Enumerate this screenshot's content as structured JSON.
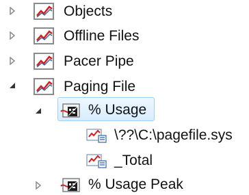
{
  "tree": {
    "items": [
      {
        "label": "Objects",
        "expander": "chevron-right-icon",
        "icon": "performance-chart-icon"
      },
      {
        "label": "Offline Files",
        "expander": "chevron-right-icon",
        "icon": "performance-chart-icon"
      },
      {
        "label": "Pacer Pipe",
        "expander": "chevron-right-icon",
        "icon": "performance-chart-icon"
      },
      {
        "label": "Paging File",
        "expander": "chevron-down-icon",
        "icon": "performance-chart-icon"
      },
      {
        "label": "% Usage",
        "expander": "chevron-down-icon",
        "icon": "counter-icon",
        "selected": true
      },
      {
        "label": "\\??\\C:\\pagefile.sys",
        "icon": "instance-icon"
      },
      {
        "label": "_Total",
        "icon": "instance-icon"
      },
      {
        "label": "% Usage Peak",
        "expander": "chevron-right-icon",
        "icon": "counter-icon"
      }
    ]
  },
  "colors": {
    "selection_fill": "#d7ecff",
    "selection_border": "#9fcff3",
    "chart_red": "#d71d1d",
    "chart_blue": "#2f5f9e",
    "text": "#111111"
  }
}
